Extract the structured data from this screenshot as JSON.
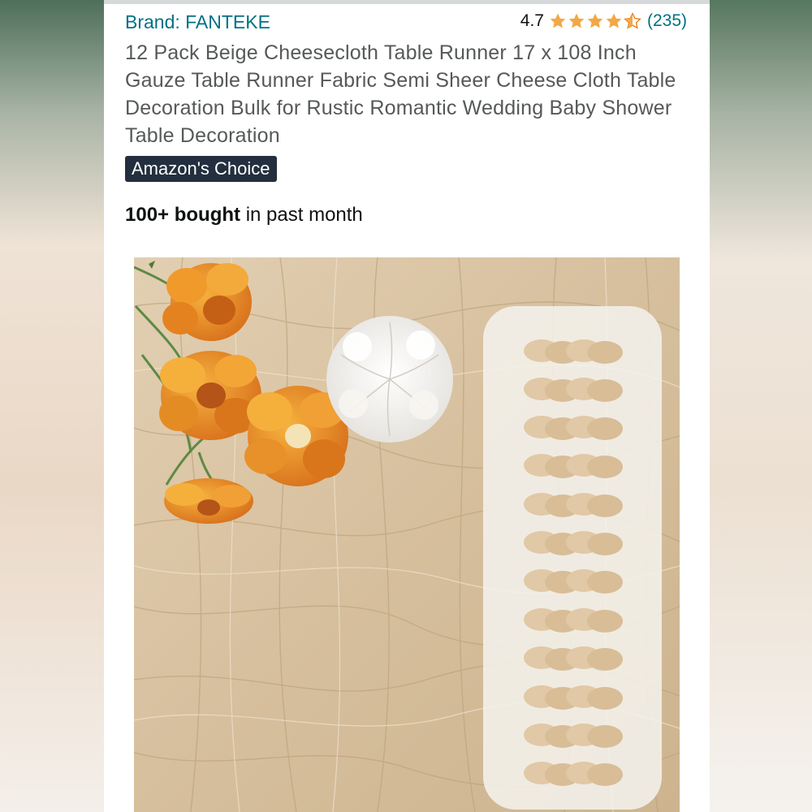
{
  "brand": {
    "label": "Brand: FANTEKE"
  },
  "rating": {
    "score": "4.7",
    "stars_value": 4.7,
    "stars_max": 5,
    "count": "(235)",
    "star_color": "#f3a847"
  },
  "product": {
    "title": "12 Pack Beige Cheesecloth Table Runner 17 x 108 Inch Gauze Table Runner Fabric Semi Sheer Cheese Cloth Table Decoration Bulk for Rustic Romantic Wedding Baby Shower Table Decoration",
    "badge": "Amazon's Choice",
    "bought_bold": "100+ bought",
    "bought_rest": " in past month",
    "image_icon": "product-photo-cheesecloth-runner"
  },
  "colors": {
    "link": "#007185",
    "badge_bg": "#232f3e",
    "fabric": "#d9c3a2",
    "flower_orange": "#e8902a"
  }
}
